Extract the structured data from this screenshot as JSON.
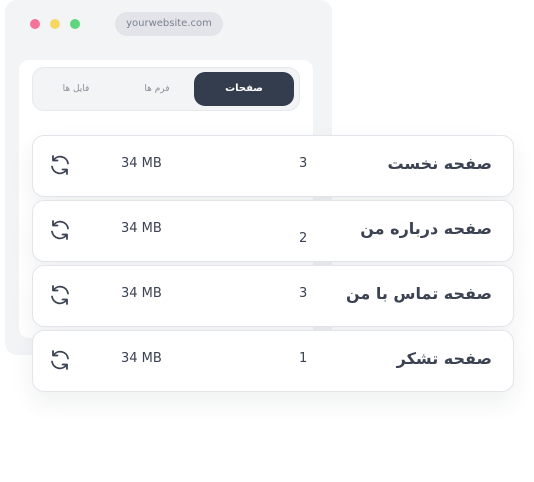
{
  "browser": {
    "url": "yourwebsite.com",
    "window_controls": [
      "close",
      "minimize",
      "maximize"
    ]
  },
  "tabs": [
    {
      "label": "فایل ها",
      "active": false
    },
    {
      "label": "فرم ها",
      "active": false
    },
    {
      "label": "صفحات",
      "active": true
    }
  ],
  "pages": [
    {
      "title": "صفحه نخست",
      "count": "3",
      "size": "34 MB",
      "icon": "refresh-icon"
    },
    {
      "title": "صفحه درباره من",
      "count": "2",
      "size": "34 MB",
      "icon": "refresh-icon"
    },
    {
      "title": "صفحه تماس با من",
      "count": "3",
      "size": "34 MB",
      "icon": "refresh-icon"
    },
    {
      "title": "صفحه تشکر",
      "count": "1",
      "size": "34 MB",
      "icon": "refresh-icon"
    }
  ],
  "colors": {
    "active_tab_bg": "#343d4e",
    "dot_red": "#f5739a",
    "dot_yellow": "#f7d764",
    "dot_green": "#5fd67d"
  }
}
